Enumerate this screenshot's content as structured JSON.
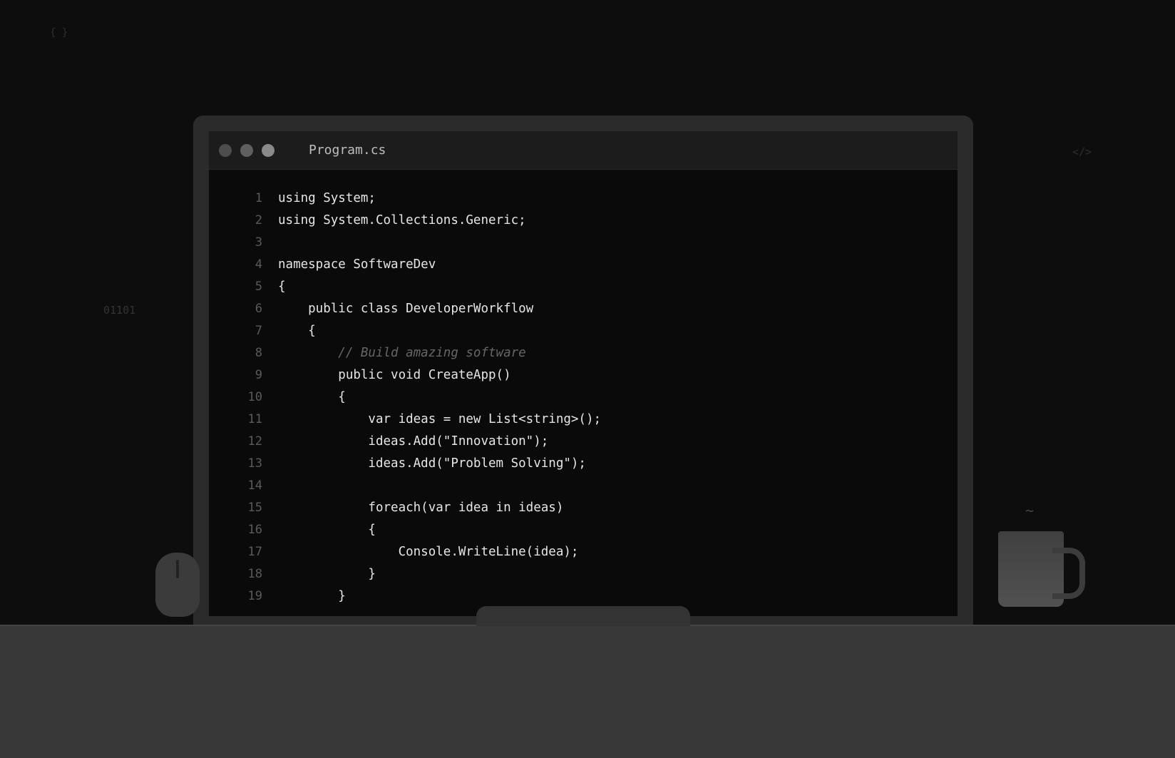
{
  "decor": {
    "braces": "{ }",
    "tag": "</>",
    "binary": "01101",
    "steam": "~"
  },
  "editor": {
    "filename": "Program.cs",
    "lines": [
      {
        "num": "1",
        "text": "using System;"
      },
      {
        "num": "2",
        "text": "using System.Collections.Generic;"
      },
      {
        "num": "3",
        "text": ""
      },
      {
        "num": "4",
        "text": "namespace SoftwareDev"
      },
      {
        "num": "5",
        "text": "{"
      },
      {
        "num": "6",
        "text": "    public class DeveloperWorkflow"
      },
      {
        "num": "7",
        "text": "    {"
      },
      {
        "num": "8",
        "text": "        // Build amazing software"
      },
      {
        "num": "9",
        "text": "        public void CreateApp()"
      },
      {
        "num": "10",
        "text": "        {"
      },
      {
        "num": "11",
        "text": "            var ideas = new List<string>();"
      },
      {
        "num": "12",
        "text": "            ideas.Add(\"Innovation\");"
      },
      {
        "num": "13",
        "text": "            ideas.Add(\"Problem Solving\");"
      },
      {
        "num": "14",
        "text": ""
      },
      {
        "num": "15",
        "text": "            foreach(var idea in ideas)"
      },
      {
        "num": "16",
        "text": "            {"
      },
      {
        "num": "17",
        "text": "                Console.WriteLine(idea);"
      },
      {
        "num": "18",
        "text": "            }"
      },
      {
        "num": "19",
        "text": "        }"
      }
    ]
  }
}
